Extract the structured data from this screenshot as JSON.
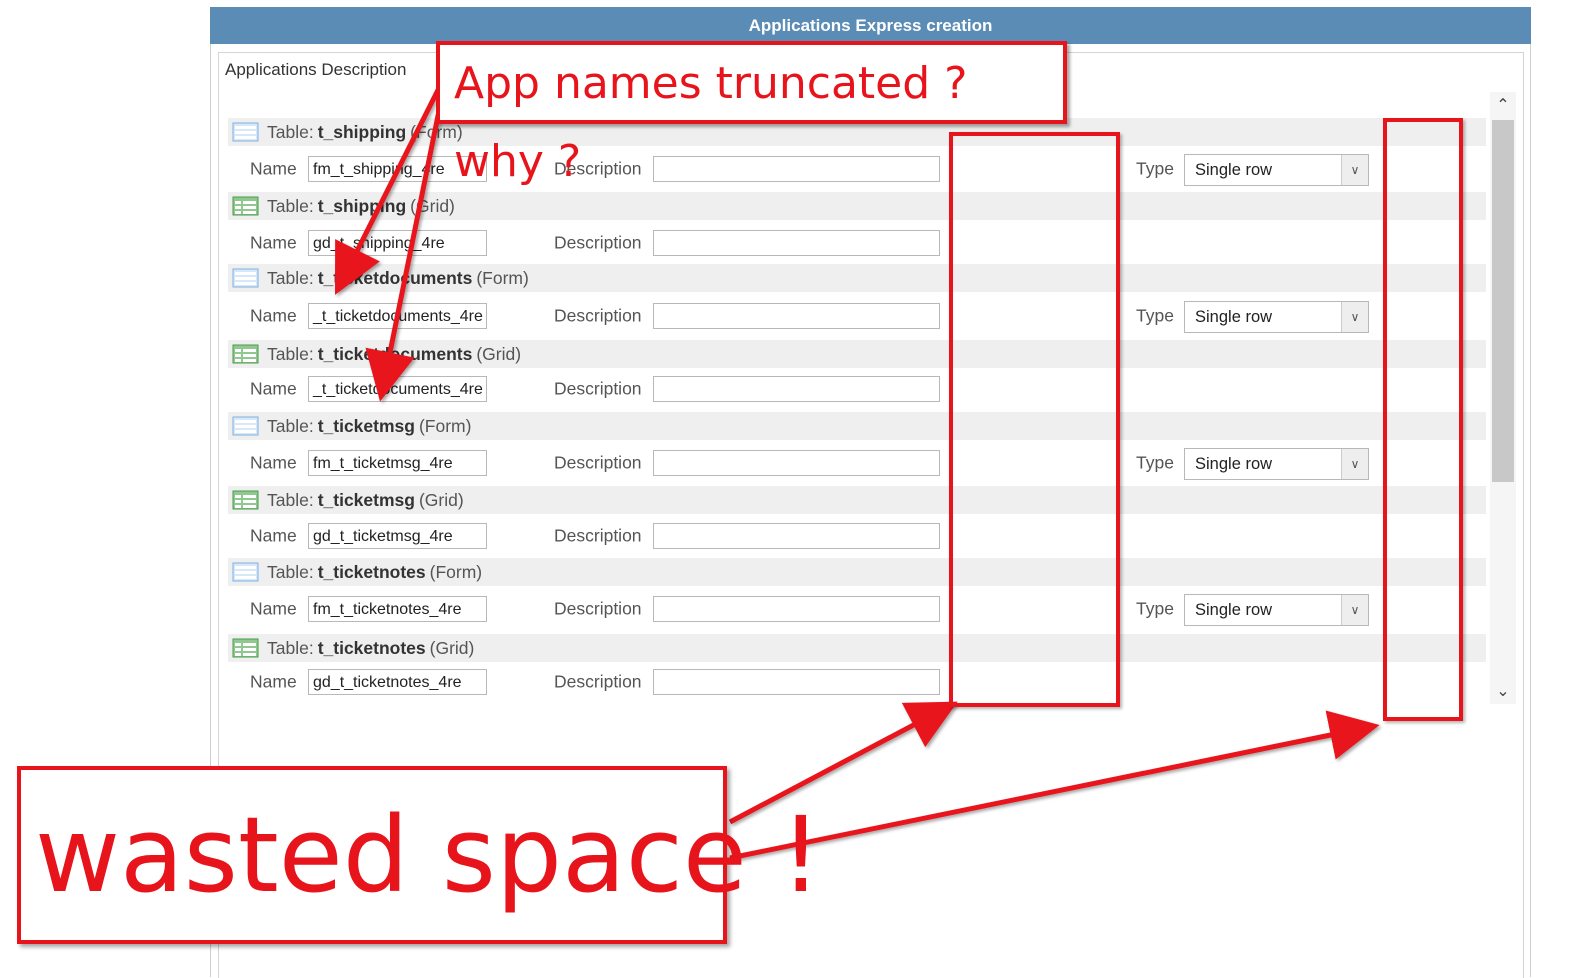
{
  "window": {
    "title": "Applications Express creation"
  },
  "panel": {
    "legend": "Applications Description"
  },
  "labels": {
    "table_prefix": "Table:",
    "name": "Name",
    "description": "Description",
    "type": "Type"
  },
  "rows": [
    {
      "table": "t_shipping",
      "kind": "(Form)",
      "icon": "form-icon",
      "name_value": "fm_t_shipping_4re",
      "description_value": "",
      "type_value": "Single row"
    },
    {
      "table": "t_shipping",
      "kind": "(Grid)",
      "icon": "grid-icon",
      "name_value": "gd_t_shipping_4re",
      "description_value": ""
    },
    {
      "table": "t_ticketdocuments",
      "kind": "(Form)",
      "icon": "form-icon",
      "name_value": "_t_ticketdocuments_4re",
      "description_value": "",
      "type_value": "Single row"
    },
    {
      "table": "t_ticketdocuments",
      "kind": "(Grid)",
      "icon": "grid-icon",
      "name_value": "_t_ticketdocuments_4re",
      "description_value": ""
    },
    {
      "table": "t_ticketmsg",
      "kind": "(Form)",
      "icon": "form-icon",
      "name_value": "fm_t_ticketmsg_4re",
      "description_value": "",
      "type_value": "Single row"
    },
    {
      "table": "t_ticketmsg",
      "kind": "(Grid)",
      "icon": "grid-icon",
      "name_value": "gd_t_ticketmsg_4re",
      "description_value": ""
    },
    {
      "table": "t_ticketnotes",
      "kind": "(Form)",
      "icon": "form-icon",
      "name_value": "fm_t_ticketnotes_4re",
      "description_value": "",
      "type_value": "Single row"
    },
    {
      "table": "t_ticketnotes",
      "kind": "(Grid)",
      "icon": "grid-icon",
      "name_value": "gd_t_ticketnotes_4re",
      "description_value": ""
    }
  ],
  "annotations": {
    "callout_top": "App names truncated ? why ?",
    "callout_bottom": "wasted space !",
    "color": "#e8141b"
  },
  "colors": {
    "title_bar": "#5b8cb6",
    "row_header": "#efefef"
  }
}
